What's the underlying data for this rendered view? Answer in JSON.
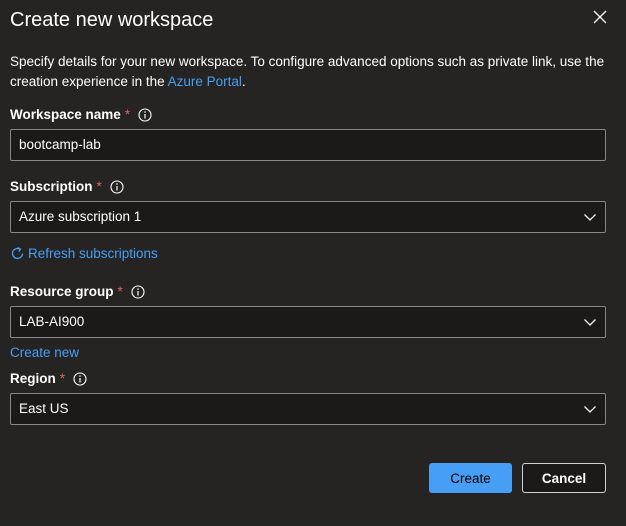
{
  "dialog": {
    "title": "Create new workspace",
    "description_prefix": "Specify details for your new workspace. To configure advanced options such as private link, use the creation experience in the ",
    "description_link": "Azure Portal",
    "description_suffix": "."
  },
  "fields": {
    "workspace_name": {
      "label": "Workspace name",
      "required_mark": "*",
      "value": "bootcamp-lab"
    },
    "subscription": {
      "label": "Subscription",
      "required_mark": "*",
      "value": "Azure subscription 1"
    },
    "resource_group": {
      "label": "Resource group",
      "required_mark": "*",
      "value": "LAB-AI900"
    },
    "region": {
      "label": "Region",
      "required_mark": "*",
      "value": "East US"
    }
  },
  "links": {
    "refresh_subscriptions": "Refresh subscriptions",
    "create_new": "Create new"
  },
  "buttons": {
    "create": "Create",
    "cancel": "Cancel"
  },
  "icons": {
    "close": "close-icon",
    "info": "info-icon",
    "chevron": "chevron-down-icon",
    "refresh": "refresh-icon"
  },
  "colors": {
    "background": "#252423",
    "accent": "#479ef5",
    "required": "#dc626d"
  }
}
